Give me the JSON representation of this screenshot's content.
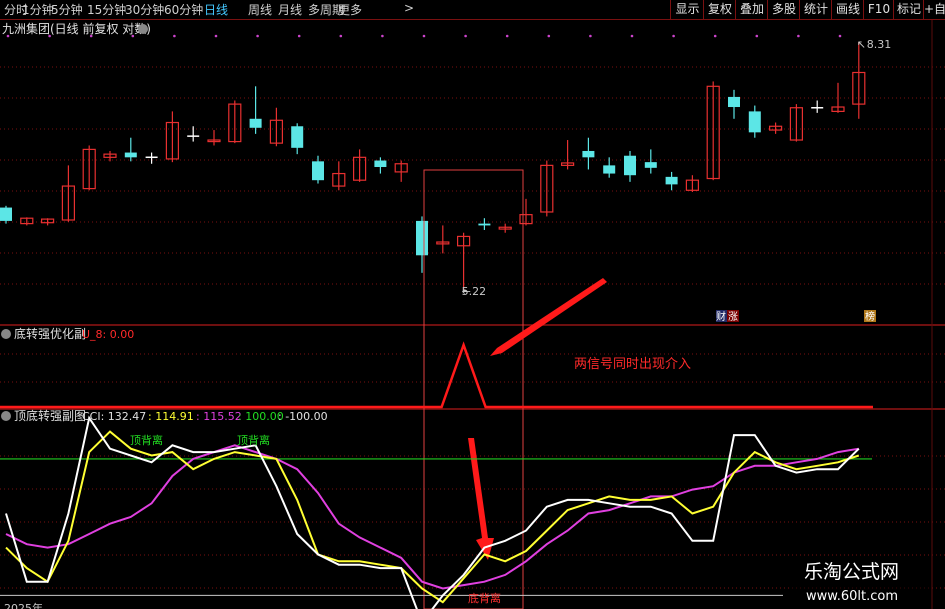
{
  "toolbar": {
    "periods": [
      "分时",
      "1分钟",
      "5分钟",
      "15分钟",
      "30分钟",
      "60分钟",
      "日线",
      "周线",
      "月线",
      "多周期",
      "更多"
    ],
    "active_period": "日线",
    "more_arrow": ">",
    "buttons": [
      "显示",
      "复权",
      "叠加",
      "多股",
      "统计",
      "画线",
      "F10",
      "标记",
      "+自"
    ]
  },
  "main_panel": {
    "title": "九洲集团(日线 前复权 对数)",
    "high_label": "8.31",
    "low_label": "5.22",
    "tag_cai": "财",
    "tag_zhang": "涨",
    "tag_bang": "榜",
    "colors": {
      "up": "#e83030",
      "down": "#5ce6e6",
      "neutral": "#ffffff",
      "grid": "#7a1010",
      "dot": "#cc44cc"
    }
  },
  "sub1_panel": {
    "title": "底转强优化副",
    "value_label": "U_8: 0.00",
    "annotation": "两信号同时出现介入"
  },
  "sub2_panel": {
    "title": "顶底转强副图",
    "cci_label": "CCI: 132.47",
    "v1": ": 114.91",
    "v2": ": 115.52",
    "v3": ": 100.00",
    "v4": ": -100.00",
    "top_div_1": "顶背离",
    "top_div_2": "顶背离",
    "bottom_div": "底背离",
    "year_label": "2025年"
  },
  "watermark": {
    "line1": "乐淘公式网",
    "line2": "www.60lt.com"
  },
  "chart_data": {
    "type": "candlestick",
    "price_axis": {
      "scale": "log",
      "high": 8.31,
      "low": 5.22
    },
    "candles": [
      {
        "o": 6.1,
        "c": 5.95,
        "h": 6.12,
        "l": 5.92,
        "t": "down"
      },
      {
        "o": 5.92,
        "c": 5.98,
        "h": 5.99,
        "l": 5.9,
        "t": "up"
      },
      {
        "o": 5.93,
        "c": 5.97,
        "h": 5.98,
        "l": 5.9,
        "t": "up"
      },
      {
        "o": 5.96,
        "c": 6.35,
        "h": 6.6,
        "l": 5.94,
        "t": "up"
      },
      {
        "o": 6.32,
        "c": 6.8,
        "h": 6.85,
        "l": 6.3,
        "t": "up"
      },
      {
        "o": 6.7,
        "c": 6.74,
        "h": 6.78,
        "l": 6.65,
        "t": "up"
      },
      {
        "o": 6.76,
        "c": 6.7,
        "h": 6.95,
        "l": 6.65,
        "t": "down"
      },
      {
        "o": 6.71,
        "c": 6.71,
        "h": 6.76,
        "l": 6.62,
        "t": "doji"
      },
      {
        "o": 6.68,
        "c": 7.15,
        "h": 7.3,
        "l": 6.64,
        "t": "up"
      },
      {
        "o": 6.98,
        "c": 6.98,
        "h": 7.1,
        "l": 6.9,
        "t": "doji"
      },
      {
        "o": 6.9,
        "c": 6.92,
        "h": 7.05,
        "l": 6.85,
        "t": "up"
      },
      {
        "o": 6.9,
        "c": 7.4,
        "h": 7.45,
        "l": 6.88,
        "t": "up"
      },
      {
        "o": 7.2,
        "c": 7.08,
        "h": 7.65,
        "l": 7.0,
        "t": "down"
      },
      {
        "o": 6.88,
        "c": 7.18,
        "h": 7.35,
        "l": 6.84,
        "t": "up"
      },
      {
        "o": 7.1,
        "c": 6.82,
        "h": 7.14,
        "l": 6.74,
        "t": "down"
      },
      {
        "o": 6.65,
        "c": 6.42,
        "h": 6.72,
        "l": 6.38,
        "t": "down"
      },
      {
        "o": 6.35,
        "c": 6.5,
        "h": 6.65,
        "l": 6.3,
        "t": "up"
      },
      {
        "o": 6.42,
        "c": 6.7,
        "h": 6.8,
        "l": 6.4,
        "t": "up"
      },
      {
        "o": 6.66,
        "c": 6.58,
        "h": 6.7,
        "l": 6.5,
        "t": "down"
      },
      {
        "o": 6.52,
        "c": 6.62,
        "h": 6.66,
        "l": 6.4,
        "t": "up"
      },
      {
        "o": 5.95,
        "c": 5.58,
        "h": 6.0,
        "l": 5.4,
        "t": "down"
      },
      {
        "o": 5.72,
        "c": 5.7,
        "h": 5.9,
        "l": 5.6,
        "t": "up"
      },
      {
        "o": 5.68,
        "c": 5.78,
        "h": 5.82,
        "l": 5.22,
        "t": "up"
      },
      {
        "o": 5.92,
        "c": 5.9,
        "h": 5.98,
        "l": 5.85,
        "t": "down"
      },
      {
        "o": 5.86,
        "c": 5.88,
        "h": 5.92,
        "l": 5.82,
        "t": "up"
      },
      {
        "o": 5.92,
        "c": 6.02,
        "h": 6.2,
        "l": 5.9,
        "t": "up"
      },
      {
        "o": 6.05,
        "c": 6.6,
        "h": 6.66,
        "l": 6.0,
        "t": "up"
      },
      {
        "o": 6.6,
        "c": 6.63,
        "h": 6.92,
        "l": 6.55,
        "t": "up"
      },
      {
        "o": 6.78,
        "c": 6.7,
        "h": 6.95,
        "l": 6.55,
        "t": "down"
      },
      {
        "o": 6.6,
        "c": 6.5,
        "h": 6.7,
        "l": 6.45,
        "t": "down"
      },
      {
        "o": 6.72,
        "c": 6.48,
        "h": 6.78,
        "l": 6.4,
        "t": "down"
      },
      {
        "o": 6.64,
        "c": 6.57,
        "h": 6.8,
        "l": 6.5,
        "t": "down"
      },
      {
        "o": 6.46,
        "c": 6.37,
        "h": 6.52,
        "l": 6.3,
        "t": "down"
      },
      {
        "o": 6.3,
        "c": 6.42,
        "h": 6.48,
        "l": 6.28,
        "t": "up"
      },
      {
        "o": 6.44,
        "c": 7.65,
        "h": 7.72,
        "l": 6.42,
        "t": "up"
      },
      {
        "o": 7.5,
        "c": 7.36,
        "h": 7.6,
        "l": 7.2,
        "t": "down"
      },
      {
        "o": 7.3,
        "c": 7.02,
        "h": 7.38,
        "l": 6.95,
        "t": "down"
      },
      {
        "o": 7.05,
        "c": 7.1,
        "h": 7.15,
        "l": 7.0,
        "t": "up"
      },
      {
        "o": 6.92,
        "c": 7.35,
        "h": 7.4,
        "l": 6.9,
        "t": "up"
      },
      {
        "o": 7.36,
        "c": 7.36,
        "h": 7.45,
        "l": 7.28,
        "t": "doji"
      },
      {
        "o": 7.3,
        "c": 7.36,
        "h": 7.7,
        "l": 7.28,
        "t": "up"
      },
      {
        "o": 7.4,
        "c": 7.85,
        "h": 8.31,
        "l": 7.2,
        "t": "up"
      }
    ],
    "signal_peak_index": 22,
    "cci_levels": {
      "upper": 100,
      "lower": -100
    },
    "cci_range": [
      -120,
      160
    ],
    "series": [
      {
        "name": "CCI",
        "color": "#ffffff",
        "values": [
          20,
          -80,
          -80,
          20,
          160,
          115,
          105,
          95,
          120,
          110,
          110,
          115,
          120,
          60,
          -10,
          -40,
          -55,
          -55,
          -60,
          -60,
          -140,
          -100,
          -70,
          -30,
          -20,
          -5,
          30,
          40,
          40,
          35,
          30,
          30,
          20,
          -20,
          -20,
          135,
          135,
          90,
          80,
          85,
          85,
          115
        ]
      },
      {
        "name": "V1",
        "color": "#ffff33",
        "values": [
          -30,
          -60,
          -80,
          -20,
          110,
          140,
          115,
          105,
          110,
          85,
          100,
          110,
          105,
          100,
          40,
          -40,
          -50,
          -50,
          -55,
          -60,
          -90,
          -110,
          -75,
          -40,
          -50,
          -35,
          -5,
          25,
          35,
          45,
          40,
          40,
          45,
          20,
          30,
          80,
          110,
          95,
          85,
          90,
          95,
          105
        ]
      },
      {
        "name": "V2",
        "color": "#e040e0",
        "values": [
          -10,
          -25,
          -30,
          -25,
          -10,
          5,
          15,
          35,
          75,
          100,
          110,
          120,
          110,
          100,
          85,
          50,
          5,
          -15,
          -30,
          -45,
          -80,
          -90,
          -85,
          -80,
          -70,
          -50,
          -25,
          -5,
          20,
          25,
          35,
          45,
          45,
          55,
          60,
          80,
          90,
          90,
          95,
          100,
          110,
          115
        ]
      }
    ],
    "xlabel": "",
    "ylabel": ""
  }
}
